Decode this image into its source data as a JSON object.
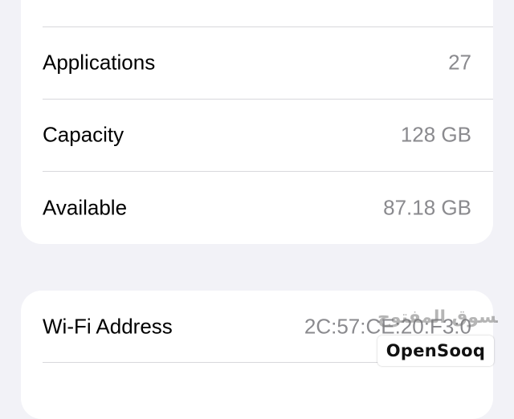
{
  "storage_card": {
    "rows": [
      {
        "label": "Applications",
        "value": "27"
      },
      {
        "label": "Capacity",
        "value": "128 GB"
      },
      {
        "label": "Available",
        "value": "87.18 GB"
      }
    ]
  },
  "network_card": {
    "rows": [
      {
        "label": "Wi-Fi Address",
        "value": "2C:57:CE:20:F3:0"
      }
    ]
  },
  "watermark": {
    "arabic_text": "السوق المفتوح",
    "badge_text": "OpenSooq"
  },
  "colors": {
    "background": "#f2f2f7",
    "card": "#ffffff",
    "label": "#000000",
    "value": "#8a8a8e",
    "separator": "#d8d8dc"
  }
}
